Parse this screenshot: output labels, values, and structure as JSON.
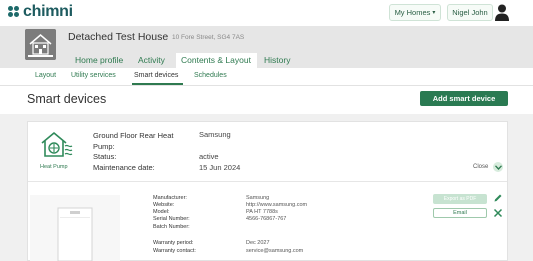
{
  "app": {
    "logo_text": "chimni"
  },
  "header": {
    "homes_button": "My Homes",
    "user_button": "Nigel John"
  },
  "house": {
    "title": "Detached Test House",
    "address": "10 Fore Street, SG4 7AS",
    "tabs": [
      {
        "label": "Home profile"
      },
      {
        "label": "Activity"
      },
      {
        "label": "Contents & Layout"
      },
      {
        "label": "History"
      }
    ]
  },
  "subtabs": [
    {
      "label": "Layout"
    },
    {
      "label": "Utility services"
    },
    {
      "label": "Smart devices"
    },
    {
      "label": "Schedules"
    }
  ],
  "page": {
    "title": "Smart devices",
    "add_button": "Add smart device"
  },
  "device": {
    "type_label": "Heat Pump",
    "name": "Ground Floor Rear Heat Pump:",
    "brand": "Samsung",
    "status_label": "Status:",
    "status_value": "active",
    "maintenance_label": "Maintenance date:",
    "maintenance_value": "15 Jun 2024",
    "close_label": "Close",
    "details": [
      {
        "label": "Manufacturer:",
        "value": "Samsung"
      },
      {
        "label": "Website:",
        "value": "http://www.samsung.com"
      },
      {
        "label": "Model:",
        "value": "PA HT 7788s"
      },
      {
        "label": "Serial Number:",
        "value": "4566-76867-767"
      },
      {
        "label": "Batch Number:",
        "value": ""
      },
      {
        "label": "Warranty period:",
        "value": "Dec 2027"
      },
      {
        "label": "Warranty contact:",
        "value": "service@samsung.com"
      }
    ],
    "export_button": "Export as PDF",
    "email_button": "Email"
  },
  "colors": {
    "brand_green": "#2a7a52",
    "tab_green": "#2f7a50",
    "logo_teal": "#1d5b5f"
  }
}
